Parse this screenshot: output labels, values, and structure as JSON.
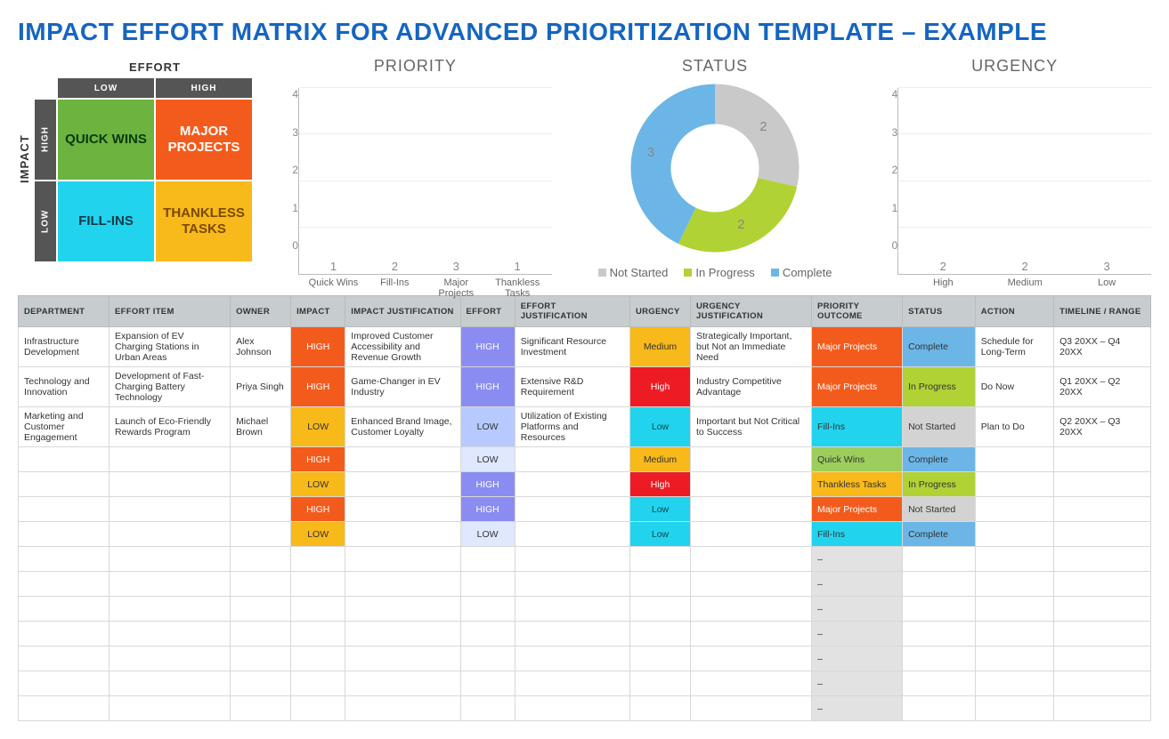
{
  "title": "IMPACT EFFORT MATRIX FOR ADVANCED PRIORITIZATION TEMPLATE – EXAMPLE",
  "matrix": {
    "effort_label": "EFFORT",
    "impact_label": "IMPACT",
    "cols": [
      "LOW",
      "HIGH"
    ],
    "rows": [
      "HIGH",
      "LOW"
    ],
    "quads": {
      "tl": "QUICK WINS",
      "tr": "MAJOR PROJECTS",
      "bl": "FILL-INS",
      "br": "THANKLESS TASKS"
    }
  },
  "chart_data": [
    {
      "id": "priority",
      "type": "bar",
      "title": "PRIORITY",
      "ylim": [
        0,
        4
      ],
      "ticks": [
        0,
        1,
        2,
        3,
        4
      ],
      "categories": [
        "Quick Wins",
        "Fill-Ins",
        "Major Projects",
        "Thankless Tasks"
      ],
      "values": [
        1,
        2,
        3,
        1
      ],
      "colors": [
        "#6cb33f",
        "#22d3ee",
        "#f35b1c",
        "#f8b91a"
      ]
    },
    {
      "id": "status",
      "type": "pie",
      "title": "STATUS",
      "series": [
        {
          "name": "Not Started",
          "value": 2,
          "color": "#c9c9c9"
        },
        {
          "name": "In Progress",
          "value": 2,
          "color": "#b0d235"
        },
        {
          "name": "Complete",
          "value": 3,
          "color": "#6bb6e6"
        }
      ]
    },
    {
      "id": "urgency",
      "type": "bar",
      "title": "URGENCY",
      "ylim": [
        0,
        4
      ],
      "ticks": [
        0,
        1,
        2,
        3,
        4
      ],
      "categories": [
        "High",
        "Medium",
        "Low"
      ],
      "values": [
        2,
        2,
        3
      ],
      "colors": [
        "#ed1c24",
        "#f8b91a",
        "#22d3ee"
      ]
    }
  ],
  "table": {
    "headers": [
      "DEPARTMENT",
      "EFFORT ITEM",
      "OWNER",
      "IMPACT",
      "IMPACT JUSTIFICATION",
      "EFFORT",
      "EFFORT JUSTIFICATION",
      "URGENCY",
      "URGENCY JUSTIFICATION",
      "PRIORITY OUTCOME",
      "STATUS",
      "ACTION",
      "TIMELINE / RANGE"
    ],
    "widths": [
      "7.5%",
      "10%",
      "5%",
      "4.5%",
      "9.5%",
      "4.5%",
      "9.5%",
      "5%",
      "10%",
      "7.5%",
      "6%",
      "6.5%",
      "8%"
    ],
    "rows": [
      {
        "dept": "Infrastructure Development",
        "item": "Expansion of EV Charging Stations in Urban Areas",
        "owner": "Alex Johnson",
        "impact": "HIGH",
        "impact_j": "Improved Customer Accessibility and Revenue Growth",
        "effort": "HIGH",
        "effort_j": "Significant Resource Investment",
        "urg": "Medium",
        "urg_j": "Strategically Important, but Not an Immediate Need",
        "po": "Major Projects",
        "status": "Complete",
        "action": "Schedule for Long-Term",
        "timeline": "Q3 20XX – Q4 20XX"
      },
      {
        "dept": "Technology and Innovation",
        "item": "Development of Fast-Charging Battery Technology",
        "owner": "Priya Singh",
        "impact": "HIGH",
        "impact_j": "Game-Changer in EV Industry",
        "effort": "HIGH",
        "effort_j": "Extensive R&D Requirement",
        "urg": "High",
        "urg_j": "Industry Competitive Advantage",
        "po": "Major Projects",
        "status": "In Progress",
        "action": "Do Now",
        "timeline": "Q1 20XX – Q2 20XX"
      },
      {
        "dept": "Marketing and Customer Engagement",
        "item": "Launch of Eco-Friendly Rewards Program",
        "owner": "Michael Brown",
        "impact": "LOW",
        "impact_j": "Enhanced Brand Image, Customer Loyalty",
        "effort": "LOW",
        "effort_j": "Utilization of Existing Platforms and Resources",
        "urg": "Low",
        "urg_j": "Important but Not Critical to Success",
        "po": "Fill-Ins",
        "status": "Not Started",
        "action": "Plan to Do",
        "timeline": "Q2 20XX – Q3 20XX"
      },
      {
        "dept": "",
        "item": "",
        "owner": "",
        "impact": "HIGH",
        "impact_j": "",
        "effort": "LOW",
        "effort_j": "",
        "urg": "Medium",
        "urg_j": "",
        "po": "Quick Wins",
        "status": "Complete",
        "action": "",
        "timeline": ""
      },
      {
        "dept": "",
        "item": "",
        "owner": "",
        "impact": "LOW",
        "impact_j": "",
        "effort": "HIGH",
        "effort_j": "",
        "urg": "High",
        "urg_j": "",
        "po": "Thankless Tasks",
        "status": "In Progress",
        "action": "",
        "timeline": ""
      },
      {
        "dept": "",
        "item": "",
        "owner": "",
        "impact": "HIGH",
        "impact_j": "",
        "effort": "HIGH",
        "effort_j": "",
        "urg": "Low",
        "urg_j": "",
        "po": "Major Projects",
        "status": "Not Started",
        "action": "",
        "timeline": ""
      },
      {
        "dept": "",
        "item": "",
        "owner": "",
        "impact": "LOW",
        "impact_j": "",
        "effort": "LOW",
        "effort_j": "",
        "urg": "Low",
        "urg_j": "",
        "po": "Fill-Ins",
        "status": "Complete",
        "action": "",
        "timeline": ""
      },
      {
        "dept": "",
        "item": "",
        "owner": "",
        "impact": "",
        "impact_j": "",
        "effort": "",
        "effort_j": "",
        "urg": "",
        "urg_j": "",
        "po": "–",
        "status": "",
        "action": "",
        "timeline": ""
      },
      {
        "dept": "",
        "item": "",
        "owner": "",
        "impact": "",
        "impact_j": "",
        "effort": "",
        "effort_j": "",
        "urg": "",
        "urg_j": "",
        "po": "–",
        "status": "",
        "action": "",
        "timeline": ""
      },
      {
        "dept": "",
        "item": "",
        "owner": "",
        "impact": "",
        "impact_j": "",
        "effort": "",
        "effort_j": "",
        "urg": "",
        "urg_j": "",
        "po": "–",
        "status": "",
        "action": "",
        "timeline": ""
      },
      {
        "dept": "",
        "item": "",
        "owner": "",
        "impact": "",
        "impact_j": "",
        "effort": "",
        "effort_j": "",
        "urg": "",
        "urg_j": "",
        "po": "–",
        "status": "",
        "action": "",
        "timeline": ""
      },
      {
        "dept": "",
        "item": "",
        "owner": "",
        "impact": "",
        "impact_j": "",
        "effort": "",
        "effort_j": "",
        "urg": "",
        "urg_j": "",
        "po": "–",
        "status": "",
        "action": "",
        "timeline": ""
      },
      {
        "dept": "",
        "item": "",
        "owner": "",
        "impact": "",
        "impact_j": "",
        "effort": "",
        "effort_j": "",
        "urg": "",
        "urg_j": "",
        "po": "–",
        "status": "",
        "action": "",
        "timeline": ""
      },
      {
        "dept": "",
        "item": "",
        "owner": "",
        "impact": "",
        "impact_j": "",
        "effort": "",
        "effort_j": "",
        "urg": "",
        "urg_j": "",
        "po": "–",
        "status": "",
        "action": "",
        "timeline": ""
      }
    ]
  }
}
